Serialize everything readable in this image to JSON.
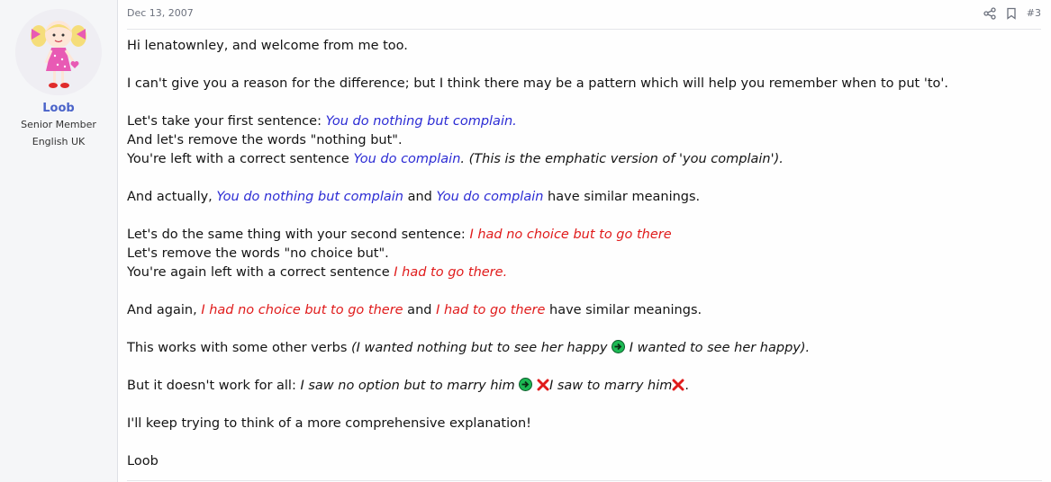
{
  "user": {
    "name": "Loob",
    "title": "Senior Member",
    "location": "English UK"
  },
  "post": {
    "date": "Dec 13, 2007",
    "number": "#3"
  },
  "content": {
    "p1": "Hi lenatownley, and welcome from me too.",
    "p2": "I can't give you a reason for the difference; but I think there may be a pattern which will help you remember when to put 'to'.",
    "p3a": "Let's take your first sentence: ",
    "p3a_ex": "You do nothing but complain.",
    "p3b": "And let's remove the words \"nothing but\".",
    "p3c": "You're left with a correct sentence ",
    "p3c_ex": "You do complain",
    "p3c_note": ". (This is the emphatic version of 'you complain').",
    "p4a": "And actually, ",
    "p4_ex1": "You do nothing but complain",
    "p4b": " and ",
    "p4_ex2": "You do complain",
    "p4c": " have similar meanings.",
    "p5a": "Let's do the same thing with your second sentence: ",
    "p5a_ex": "I had no choice but to go there",
    "p5b": "Let's remove the words \"no choice but\".",
    "p5c": "You're again left with a correct sentence ",
    "p5c_ex": "I had to go there.",
    "p6a": "And again, ",
    "p6_ex1": "I had no choice but to go there",
    "p6b": " and ",
    "p6_ex2": "I had to go there",
    "p6c": " have similar meanings.",
    "p7a": "This works with some other verbs ",
    "p7_ex1": "(I wanted nothing but to see her happy",
    "p7_ex2": " I wanted to see her happy).",
    "p8a": "But it doesn't work for all: ",
    "p8_ex1": "I saw no option but to marry him",
    "p8_ex2": "I saw to marry him",
    "p8_end": ".",
    "p9": "I'll keep trying to think of a more comprehensive explanation!",
    "p10": "Loob"
  },
  "icons": {
    "share": "share-icon",
    "bookmark": "bookmark-icon",
    "arrow": "green-arrow-icon",
    "cross": "red-cross-icon"
  },
  "colors": {
    "blue_example": "#2b2bd4",
    "red_example": "#e01b1b",
    "username": "#4a63c9",
    "arrow_green": "#1db954"
  }
}
